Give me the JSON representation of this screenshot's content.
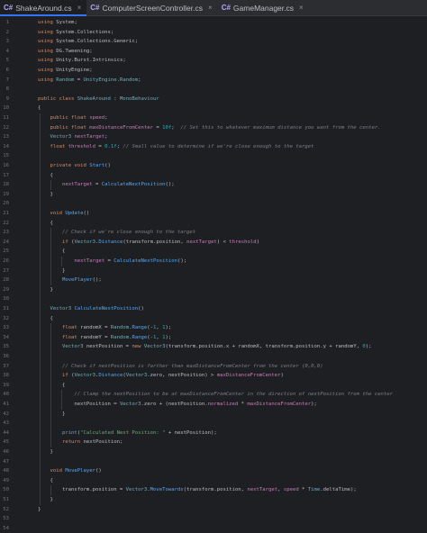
{
  "tabs": [
    {
      "icon": "C#",
      "label": "ShakeAround.cs",
      "close": "×",
      "active": true
    },
    {
      "icon": "C#",
      "label": "ComputerScreenController.cs",
      "close": "×",
      "active": false
    },
    {
      "icon": "C#",
      "label": "GameManager.cs",
      "close": "×",
      "active": false
    }
  ],
  "line_numbers": [
    "1",
    "2",
    "3",
    "4",
    "5",
    "6",
    "7",
    "8",
    "9",
    "10",
    "11",
    "12",
    "13",
    "14",
    "15",
    "16",
    "17",
    "18",
    "19",
    "20",
    "21",
    "22",
    "23",
    "24",
    "25",
    "26",
    "27",
    "28",
    "29",
    "30",
    "31",
    "32",
    "33",
    "34",
    "35",
    "36",
    "37",
    "38",
    "39",
    "40",
    "41",
    "42",
    "43",
    "44",
    "45",
    "46",
    "47",
    "48",
    "49",
    "50",
    "51",
    "52",
    "53",
    "54"
  ],
  "code": [
    [
      [
        "kw",
        "using "
      ],
      [
        "ns",
        "System"
      ],
      [
        "",
        "; "
      ]
    ],
    [
      [
        "kw",
        "using "
      ],
      [
        "ns",
        "System.Collections"
      ],
      [
        "",
        ";"
      ]
    ],
    [
      [
        "kw",
        "using "
      ],
      [
        "ns",
        "System.Collections.Generic"
      ],
      [
        "",
        ";"
      ]
    ],
    [
      [
        "kw",
        "using "
      ],
      [
        "ns",
        "DG.Tweening"
      ],
      [
        "",
        ";"
      ]
    ],
    [
      [
        "kw",
        "using "
      ],
      [
        "ns",
        "Unity.Burst.Intrinsics"
      ],
      [
        "",
        ";"
      ]
    ],
    [
      [
        "kw",
        "using "
      ],
      [
        "ns",
        "UnityEngine"
      ],
      [
        "",
        ";"
      ]
    ],
    [
      [
        "kw",
        "using "
      ],
      [
        "ty",
        "Random"
      ],
      [
        "",
        " = "
      ],
      [
        "ty",
        "UnityEngine.Random"
      ],
      [
        "",
        ";"
      ]
    ],
    [],
    [
      [
        "kw",
        "public class "
      ],
      [
        "ty",
        "ShakeAround"
      ],
      [
        "",
        " : "
      ],
      [
        "ty",
        "MonoBehaviour"
      ]
    ],
    [
      [
        "",
        "{"
      ]
    ],
    [
      [
        "",
        "    "
      ],
      [
        "kw",
        "public float "
      ],
      [
        "fld",
        "speed"
      ],
      [
        "",
        ";"
      ]
    ],
    [
      [
        "",
        "    "
      ],
      [
        "kw",
        "public float "
      ],
      [
        "fld",
        "maxDistanceFromCenter"
      ],
      [
        "",
        " = "
      ],
      [
        "num",
        "10f"
      ],
      [
        "",
        "; "
      ],
      [
        "cm",
        " // Set this to whatever maximum distance you want from the center."
      ]
    ],
    [
      [
        "",
        "    "
      ],
      [
        "ty",
        "Vector3 "
      ],
      [
        "fld",
        "nextTarget"
      ],
      [
        "",
        ";"
      ]
    ],
    [
      [
        "",
        "    "
      ],
      [
        "kw",
        "float "
      ],
      [
        "fld",
        "threshold"
      ],
      [
        "",
        " = "
      ],
      [
        "num",
        "0.1f"
      ],
      [
        "",
        "; "
      ],
      [
        "cm",
        "// Small value to determine if we're close enough to the target"
      ]
    ],
    [],
    [
      [
        "",
        "    "
      ],
      [
        "kw",
        "private void "
      ],
      [
        "fn",
        "Start"
      ],
      [
        "",
        "()"
      ]
    ],
    [
      [
        "",
        "    {"
      ]
    ],
    [
      [
        "",
        "        "
      ],
      [
        "fld",
        "nextTarget"
      ],
      [
        "",
        " = "
      ],
      [
        "fn",
        "CalculateNextPosition"
      ],
      [
        "",
        "();"
      ]
    ],
    [
      [
        "",
        "    }"
      ]
    ],
    [],
    [
      [
        "",
        "    "
      ],
      [
        "kw",
        "void "
      ],
      [
        "fn",
        "Update"
      ],
      [
        "",
        "()"
      ]
    ],
    [
      [
        "",
        "    {"
      ]
    ],
    [
      [
        "",
        "        "
      ],
      [
        "cm",
        "// Check if we're close enough to the target"
      ]
    ],
    [
      [
        "",
        "        "
      ],
      [
        "kw",
        "if "
      ],
      [
        "",
        "("
      ],
      [
        "ty",
        "Vector3"
      ],
      [
        "",
        "."
      ],
      [
        "fn",
        "Distance"
      ],
      [
        "",
        "(transform.position, "
      ],
      [
        "fld",
        "nextTarget"
      ],
      [
        "",
        ") < "
      ],
      [
        "fld",
        "threshold"
      ],
      [
        "",
        ")"
      ]
    ],
    [
      [
        "",
        "        {"
      ]
    ],
    [
      [
        "",
        "            "
      ],
      [
        "fld",
        "nextTarget"
      ],
      [
        "",
        " = "
      ],
      [
        "fn",
        "CalculateNextPosition"
      ],
      [
        "",
        "();"
      ]
    ],
    [
      [
        "",
        "        }"
      ]
    ],
    [
      [
        "",
        "        "
      ],
      [
        "fn",
        "MovePlayer"
      ],
      [
        "",
        "();"
      ]
    ],
    [
      [
        "",
        "    }"
      ]
    ],
    [],
    [
      [
        "",
        "    "
      ],
      [
        "ty",
        "Vector3 "
      ],
      [
        "fn",
        "CalculateNextPosition"
      ],
      [
        "",
        "()"
      ]
    ],
    [
      [
        "",
        "    {"
      ]
    ],
    [
      [
        "",
        "        "
      ],
      [
        "kw",
        "float "
      ],
      [
        "",
        "randomX = "
      ],
      [
        "ty",
        "Random"
      ],
      [
        "",
        "."
      ],
      [
        "fn",
        "Range"
      ],
      [
        "",
        "(-"
      ],
      [
        "num",
        "1"
      ],
      [
        "",
        ", "
      ],
      [
        "num",
        "1"
      ],
      [
        "",
        ");"
      ]
    ],
    [
      [
        "",
        "        "
      ],
      [
        "kw",
        "float "
      ],
      [
        "",
        "randomY = "
      ],
      [
        "ty",
        "Random"
      ],
      [
        "",
        "."
      ],
      [
        "fn",
        "Range"
      ],
      [
        "",
        "(-"
      ],
      [
        "num",
        "1"
      ],
      [
        "",
        ", "
      ],
      [
        "num",
        "1"
      ],
      [
        "",
        ");"
      ]
    ],
    [
      [
        "",
        "        "
      ],
      [
        "ty",
        "Vector3 "
      ],
      [
        "",
        "nextPosition = "
      ],
      [
        "kw",
        "new "
      ],
      [
        "ty",
        "Vector3"
      ],
      [
        "",
        "(transform.position.x + randomX, transform.position.y + randomY, "
      ],
      [
        "num",
        "0"
      ],
      [
        "",
        ");"
      ]
    ],
    [],
    [
      [
        "",
        "        "
      ],
      [
        "cm",
        "// Check if nextPosition is farther than maxDistanceFromCenter from the center (0,0,0)"
      ]
    ],
    [
      [
        "",
        "        "
      ],
      [
        "kw",
        "if "
      ],
      [
        "",
        "("
      ],
      [
        "ty",
        "Vector3"
      ],
      [
        "",
        "."
      ],
      [
        "fn",
        "Distance"
      ],
      [
        "",
        "("
      ],
      [
        "ty",
        "Vector3"
      ],
      [
        "",
        ".zero, nextPosition) > "
      ],
      [
        "fld",
        "maxDistanceFromCenter"
      ],
      [
        "",
        ")"
      ]
    ],
    [
      [
        "",
        "        {"
      ]
    ],
    [
      [
        "",
        "            "
      ],
      [
        "cm",
        "// Clamp the nextPosition to be at maxDistanceFromCenter in the direction of nextPosition from the center"
      ]
    ],
    [
      [
        "",
        "            nextPosition = "
      ],
      [
        "ty",
        "Vector3"
      ],
      [
        "",
        ".zero + (nextPosition."
      ],
      [
        "fld",
        "normalized"
      ],
      [
        "",
        " * "
      ],
      [
        "fld",
        "maxDistanceFromCenter"
      ],
      [
        "",
        ");"
      ]
    ],
    [
      [
        "",
        "        }"
      ]
    ],
    [],
    [
      [
        "",
        "        "
      ],
      [
        "fn",
        "print"
      ],
      [
        "",
        "("
      ],
      [
        "str",
        "\"Calculated Next Position: \""
      ],
      [
        "",
        " + nextPosition);"
      ]
    ],
    [
      [
        "",
        "        "
      ],
      [
        "kw",
        "return "
      ],
      [
        "",
        "nextPosition;"
      ]
    ],
    [
      [
        "",
        "    }"
      ]
    ],
    [],
    [
      [
        "",
        "    "
      ],
      [
        "kw",
        "void "
      ],
      [
        "fn",
        "MovePlayer"
      ],
      [
        "",
        "()"
      ]
    ],
    [
      [
        "",
        "    {"
      ]
    ],
    [
      [
        "",
        "        transform.position = "
      ],
      [
        "ty",
        "Vector3"
      ],
      [
        "",
        "."
      ],
      [
        "fn",
        "MoveTowards"
      ],
      [
        "",
        "(transform.position, "
      ],
      [
        "fld",
        "nextTarget"
      ],
      [
        "",
        ", "
      ],
      [
        "fld",
        "speed"
      ],
      [
        "",
        " * "
      ],
      [
        "ty",
        "Time"
      ],
      [
        "",
        ".deltaTime);"
      ]
    ],
    [
      [
        "",
        "    }"
      ]
    ],
    [
      [
        "",
        "}"
      ]
    ],
    [],
    []
  ]
}
